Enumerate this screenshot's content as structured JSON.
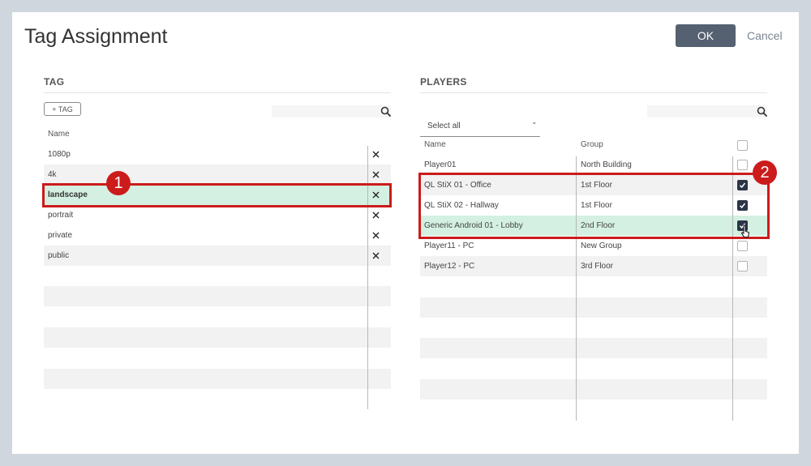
{
  "dialog": {
    "title": "Tag Assignment",
    "ok_label": "OK",
    "cancel_label": "Cancel"
  },
  "tag_panel": {
    "section_title": "TAG",
    "add_tag_label": "+ TAG",
    "column_name": "Name",
    "rows": [
      {
        "name": "1080p"
      },
      {
        "name": "4k"
      },
      {
        "name": "landscape"
      },
      {
        "name": "portrait"
      },
      {
        "name": "private"
      },
      {
        "name": "public"
      }
    ]
  },
  "players_panel": {
    "section_title": "PLAYERS",
    "select_all_label": "Select all",
    "column_name": "Name",
    "column_group": "Group",
    "rows": [
      {
        "name": "Player01",
        "group": "North Building",
        "checked": false
      },
      {
        "name": "QL StiX 01 - Office",
        "group": "1st Floor",
        "checked": true
      },
      {
        "name": "QL StiX 02 - Hallway",
        "group": "1st Floor",
        "checked": true
      },
      {
        "name": "Generic Android 01 - Lobby",
        "group": "2nd Floor",
        "checked": true
      },
      {
        "name": "Player11 - PC",
        "group": "New Group",
        "checked": false
      },
      {
        "name": "Player12 - PC",
        "group": "3rd Floor",
        "checked": false
      }
    ]
  },
  "annotations": {
    "badge_1": "1",
    "badge_2": "2"
  },
  "colors": {
    "primary_button": "#556070",
    "selected_row": "#d4f0e2",
    "annotation_red": "#cc1b1b",
    "checkbox_checked": "#2b3547"
  }
}
